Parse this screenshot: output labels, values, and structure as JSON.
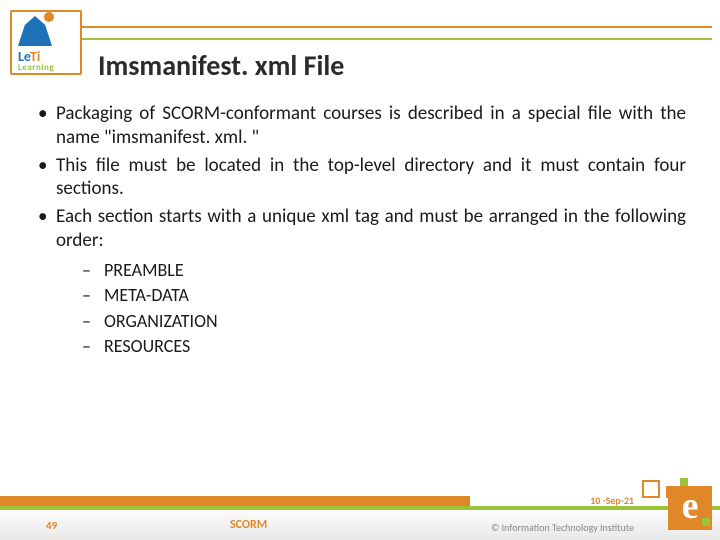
{
  "logo": {
    "brand_e": "Le",
    "brand_ti": "Ti",
    "brand_sub": "Learning"
  },
  "title": "Imsmanifest. xml File",
  "bullets": [
    "Packaging of SCORM-conformant courses is described in a special file with the name \"imsmanifest. xml. \"",
    "This file must be located in the top-level directory and it must contain four sections.",
    "Each section starts with a unique xml tag and must be arranged in the following order:"
  ],
  "sub_bullets": [
    "PREAMBLE",
    "META-DATA",
    "ORGANIZATION",
    "RESOURCES"
  ],
  "footer": {
    "slide_number": "49",
    "center": "SCORM",
    "date": "10 -Sep-21",
    "copyright": "© Information Technology Institute"
  },
  "br_logo_letter": "e"
}
